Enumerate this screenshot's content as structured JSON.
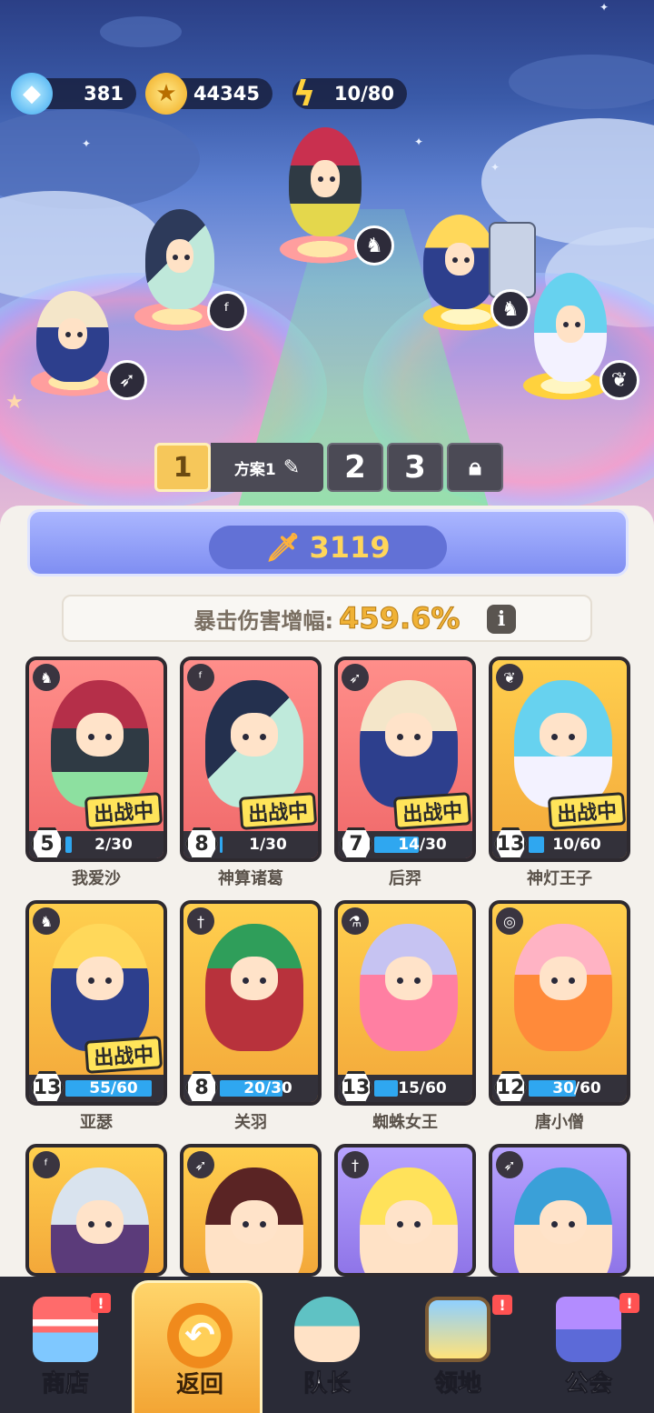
{
  "currencies": [
    {
      "name": "diamond",
      "value": "381",
      "icon": "diamond-icon"
    },
    {
      "name": "gold",
      "value": "44345",
      "icon": "gold-coin-icon"
    },
    {
      "name": "energy",
      "value": "10/80",
      "icon": "lightning-icon"
    }
  ],
  "schemes": {
    "active": "1",
    "active_name": "方案1",
    "others": [
      "2",
      "3"
    ]
  },
  "power": "3119",
  "crit": {
    "label": "暴击伤害增幅:",
    "value": "459.6%",
    "info": "i"
  },
  "battle_label": "出战中",
  "heroes": [
    {
      "name": "我爱沙",
      "level": "5",
      "progress": "2/30",
      "pct": 0.067,
      "color": "red",
      "type": "beast-icon",
      "in_battle": true
    },
    {
      "name": "神算诸葛",
      "level": "8",
      "progress": "1/30",
      "pct": 0.033,
      "color": "red",
      "type": "staff-icon",
      "in_battle": true
    },
    {
      "name": "后羿",
      "level": "7",
      "progress": "14/30",
      "pct": 0.467,
      "color": "red",
      "type": "bow-icon",
      "in_battle": true
    },
    {
      "name": "神灯王子",
      "level": "13",
      "progress": "10/60",
      "pct": 0.167,
      "color": "gold",
      "type": "wings-icon",
      "in_battle": true
    },
    {
      "name": "亚瑟",
      "level": "13",
      "progress": "55/60",
      "pct": 0.917,
      "color": "gold",
      "type": "beast-icon",
      "in_battle": true
    },
    {
      "name": "关羽",
      "level": "8",
      "progress": "20/30",
      "pct": 0.667,
      "color": "gold",
      "type": "sword-icon",
      "in_battle": false
    },
    {
      "name": "蜘蛛女王",
      "level": "13",
      "progress": "15/60",
      "pct": 0.25,
      "color": "gold",
      "type": "potion-icon",
      "in_battle": false
    },
    {
      "name": "唐小僧",
      "level": "12",
      "progress": "30/60",
      "pct": 0.5,
      "color": "gold",
      "type": "spiral-icon",
      "in_battle": false
    },
    {
      "name": "",
      "level": "",
      "progress": "",
      "pct": 0,
      "color": "gold",
      "type": "staff-icon",
      "in_battle": false
    },
    {
      "name": "",
      "level": "",
      "progress": "",
      "pct": 0,
      "color": "gold",
      "type": "bow-icon",
      "in_battle": false
    },
    {
      "name": "",
      "level": "",
      "progress": "",
      "pct": 0,
      "color": "purple",
      "type": "sword-icon",
      "in_battle": false
    },
    {
      "name": "",
      "level": "",
      "progress": "",
      "pct": 0,
      "color": "purple",
      "type": "bow-icon",
      "in_battle": false
    }
  ],
  "nav": [
    {
      "label": "商店",
      "icon": "shop-icon",
      "badge": "!"
    },
    {
      "label": "返回",
      "icon": "return-icon",
      "badge": ""
    },
    {
      "label": "队长",
      "icon": "captain-icon",
      "badge": ""
    },
    {
      "label": "领地",
      "icon": "territory-icon",
      "badge": "!"
    },
    {
      "label": "公会",
      "icon": "guild-icon",
      "badge": "!"
    }
  ],
  "colors": {
    "accent_gold": "#f6c75a",
    "power_blue": "#6271d6",
    "progress_blue": "#2fa7f0"
  }
}
